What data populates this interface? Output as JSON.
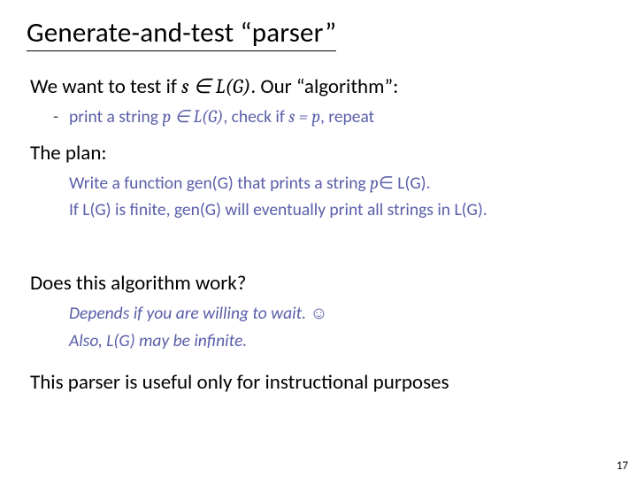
{
  "title": "Generate-and-test “parser”",
  "l1_pre": "We want to test if ",
  "l1_math": "s ∈ L(G)",
  "l1_post": ". Our “algorithm”:",
  "dash": "-",
  "l2_pre": "print a string ",
  "l2_math1": "p ∈ L(G)",
  "l2_mid": ", check if ",
  "l2_math2": "s = p",
  "l2_post": ", repeat",
  "l3": "The plan:",
  "l4_pre": "Write a function gen(G) that prints a string ",
  "l4_p": "p",
  "l4_in": "∈",
  "l4_LG": " L(G).",
  "l5": "If L(G) is finite, gen(G) will eventually print all strings in L(G).",
  "l6": "Does this algorithm work?",
  "l7a": "Depends if you are willing to wait. ",
  "l7smile": "☺",
  "l8": "Also, L(G) may be infinite.",
  "l9": "This parser is useful only for instructional purposes",
  "page": "17"
}
